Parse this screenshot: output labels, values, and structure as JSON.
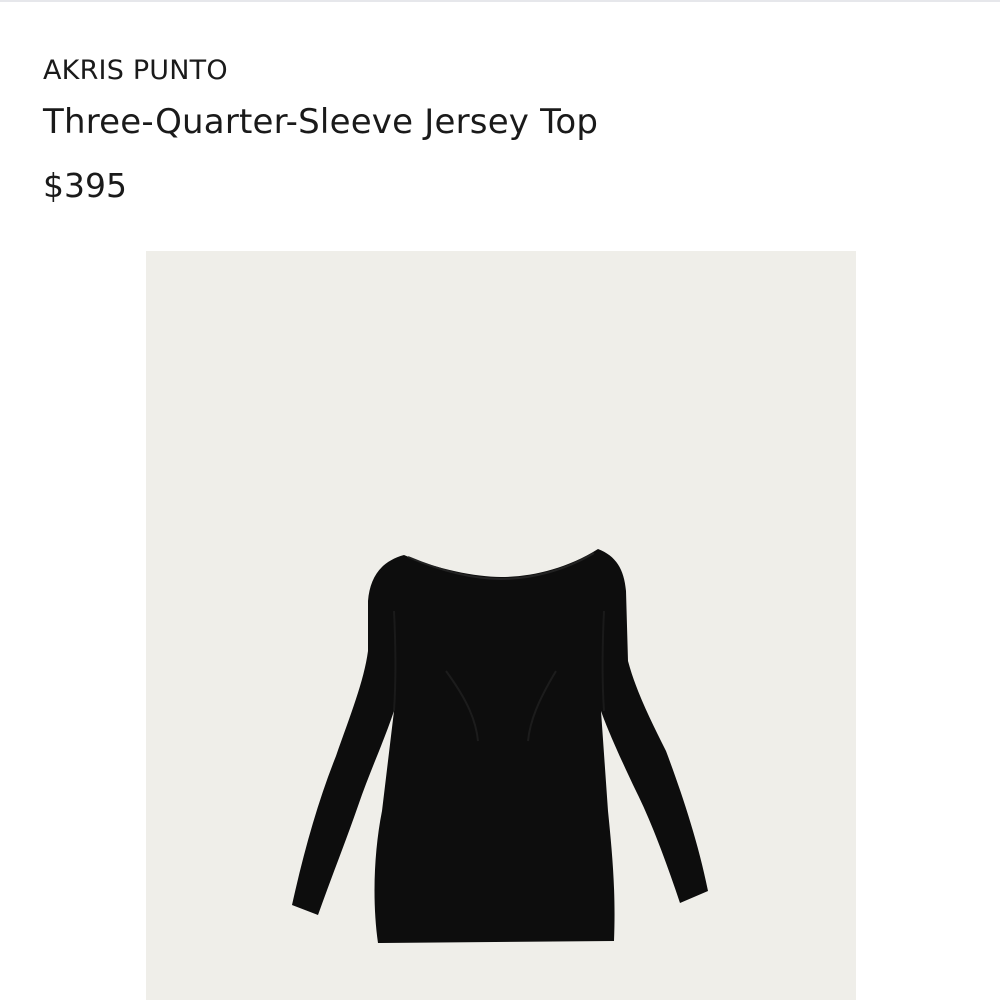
{
  "product": {
    "brand": "AKRIS PUNTO",
    "title": "Three-Quarter-Sleeve Jersey Top",
    "price": "$395"
  },
  "image": {
    "subject": "black-jersey-top",
    "background_color": "#efeee9",
    "garment_color": "#0d0d0d"
  }
}
